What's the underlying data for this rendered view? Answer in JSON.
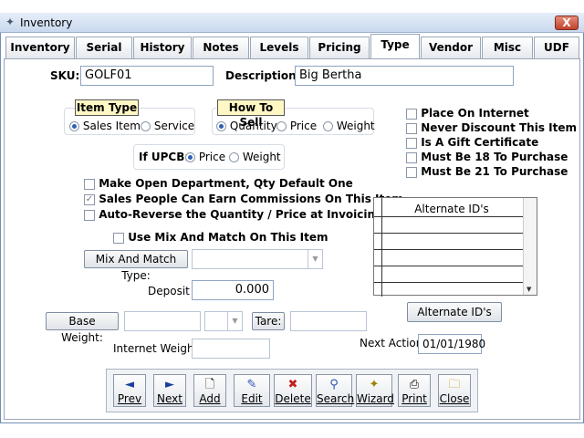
{
  "window": {
    "title": "Inventory",
    "close_label": "X"
  },
  "tabs": [
    "Inventory",
    "Serial",
    "History",
    "Notes",
    "Levels",
    "Pricing",
    "Type",
    "Vendor",
    "Misc",
    "UDF"
  ],
  "active_tab": "Type",
  "sku": {
    "label": "SKU:",
    "value": "GOLF01"
  },
  "description": {
    "label": "Description:",
    "value": "Big Bertha"
  },
  "item_type": {
    "title": "Item Type",
    "options": [
      "Sales Item",
      "Service"
    ],
    "selected": "Sales Item"
  },
  "how_to_sell": {
    "title": "How To Sell",
    "options": [
      "Quantity",
      "Price",
      "Weight"
    ],
    "selected": "Quantity"
  },
  "upcb": {
    "label": "If UPCB:",
    "options": [
      "Price",
      "Weight"
    ],
    "selected": "Price"
  },
  "right_checks": [
    "Place On Internet",
    "Never Discount This Item",
    "Is A Gift Certificate",
    "Must Be 18 To Purchase",
    "Must Be 21 To Purchase"
  ],
  "left_checks": [
    {
      "label": "Make Open Department, Qty Default One",
      "checked": false
    },
    {
      "label": "Sales People Can Earn Commissions On This Item",
      "checked": true
    },
    {
      "label": "Auto-Reverse the Quantity / Price at Invoicing",
      "checked": false
    }
  ],
  "mix_match": {
    "checkbox_label": "Use Mix And Match On This Item",
    "type_button": "Mix And Match Type:"
  },
  "deposit": {
    "label": "Deposit",
    "value": "0.000"
  },
  "base_weight_button": "Base Weight:",
  "tare_button": "Tare:",
  "internet_weight_label": "Internet Weight:",
  "alternate_ids": {
    "header": "Alternate ID's",
    "button": "Alternate ID's"
  },
  "next_action": {
    "label": "Next Action:",
    "value": "01/01/1980"
  },
  "toolbar": [
    {
      "label": "Prev",
      "icon": "arrow-left-icon",
      "glyph": "◄"
    },
    {
      "label": "Next",
      "icon": "arrow-right-icon",
      "glyph": "►"
    },
    {
      "label": "Add",
      "icon": "page-icon",
      "glyph": "🗋"
    },
    {
      "label": "Edit",
      "icon": "edit-icon",
      "glyph": "✎"
    },
    {
      "label": "Delete",
      "icon": "delete-icon",
      "glyph": "✖"
    },
    {
      "label": "Search",
      "icon": "binoculars-icon",
      "glyph": "⚲"
    },
    {
      "label": "Wizard",
      "icon": "wand-icon",
      "glyph": "✦"
    },
    {
      "label": "Print",
      "icon": "printer-icon",
      "glyph": "⎙"
    },
    {
      "label": "Close",
      "icon": "folder-icon",
      "glyph": "🗀"
    }
  ]
}
